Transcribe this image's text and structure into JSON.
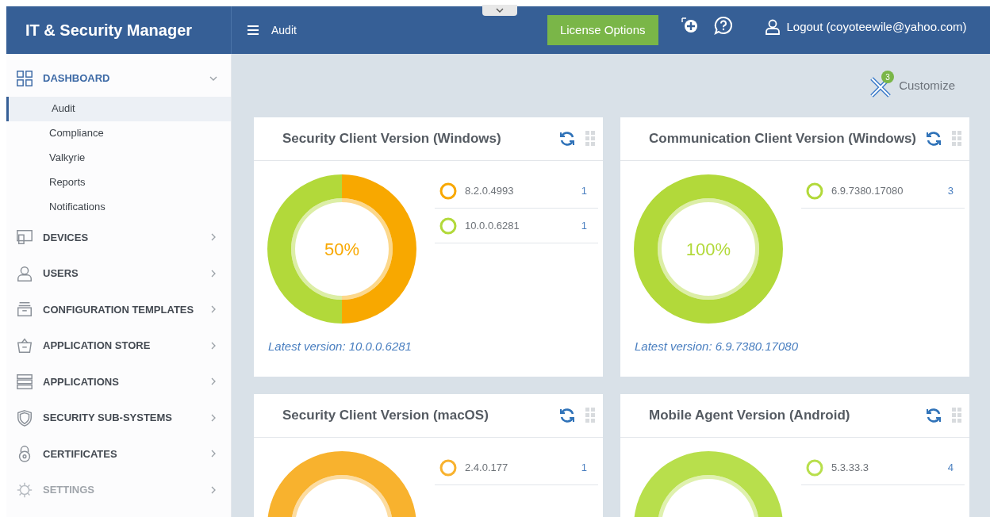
{
  "header": {
    "brand": "IT & Security Manager",
    "page_title": "Audit",
    "license_button": "License Options",
    "logout": "Logout (coyoteewile@yahoo.com)"
  },
  "sidebar": {
    "items": [
      {
        "label": "DASHBOARD",
        "expanded": true,
        "disabled": false,
        "children": [
          {
            "label": "Audit",
            "selected": true
          },
          {
            "label": "Compliance",
            "selected": false
          },
          {
            "label": "Valkyrie",
            "selected": false
          },
          {
            "label": "Reports",
            "selected": false
          },
          {
            "label": "Notifications",
            "selected": false
          }
        ]
      },
      {
        "label": "DEVICES",
        "expanded": false,
        "disabled": false
      },
      {
        "label": "USERS",
        "expanded": false,
        "disabled": false
      },
      {
        "label": "CONFIGURATION TEMPLATES",
        "expanded": false,
        "disabled": false
      },
      {
        "label": "APPLICATION STORE",
        "expanded": false,
        "disabled": false
      },
      {
        "label": "APPLICATIONS",
        "expanded": false,
        "disabled": false
      },
      {
        "label": "SECURITY SUB-SYSTEMS",
        "expanded": false,
        "disabled": false
      },
      {
        "label": "CERTIFICATES",
        "expanded": false,
        "disabled": false
      },
      {
        "label": "SETTINGS",
        "expanded": false,
        "disabled": true
      }
    ]
  },
  "customize": {
    "label": "Customize",
    "badge": "3"
  },
  "cards": [
    {
      "title": "Security Client Version (Windows)",
      "center_label": "50%",
      "latest": "Latest version: 10.0.0.6281",
      "legend": [
        {
          "version": "8.2.0.4993",
          "count": "1",
          "color": "#f8a800"
        },
        {
          "version": "10.0.0.6281",
          "count": "1",
          "color": "#b2d93a"
        }
      ]
    },
    {
      "title": "Communication Client Version (Windows)",
      "center_label": "100%",
      "latest": "Latest version: 6.9.7380.17080",
      "legend": [
        {
          "version": "6.9.7380.17080",
          "count": "3",
          "color": "#b2d93a"
        }
      ]
    },
    {
      "title": "Security Client Version (macOS)",
      "legend": [
        {
          "version": "2.4.0.177",
          "count": "1",
          "color": "#f8b22e"
        }
      ]
    },
    {
      "title": "Mobile Agent Version (Android)",
      "legend": [
        {
          "version": "5.3.33.3",
          "count": "4",
          "color": "#b8df4c"
        }
      ]
    }
  ]
}
